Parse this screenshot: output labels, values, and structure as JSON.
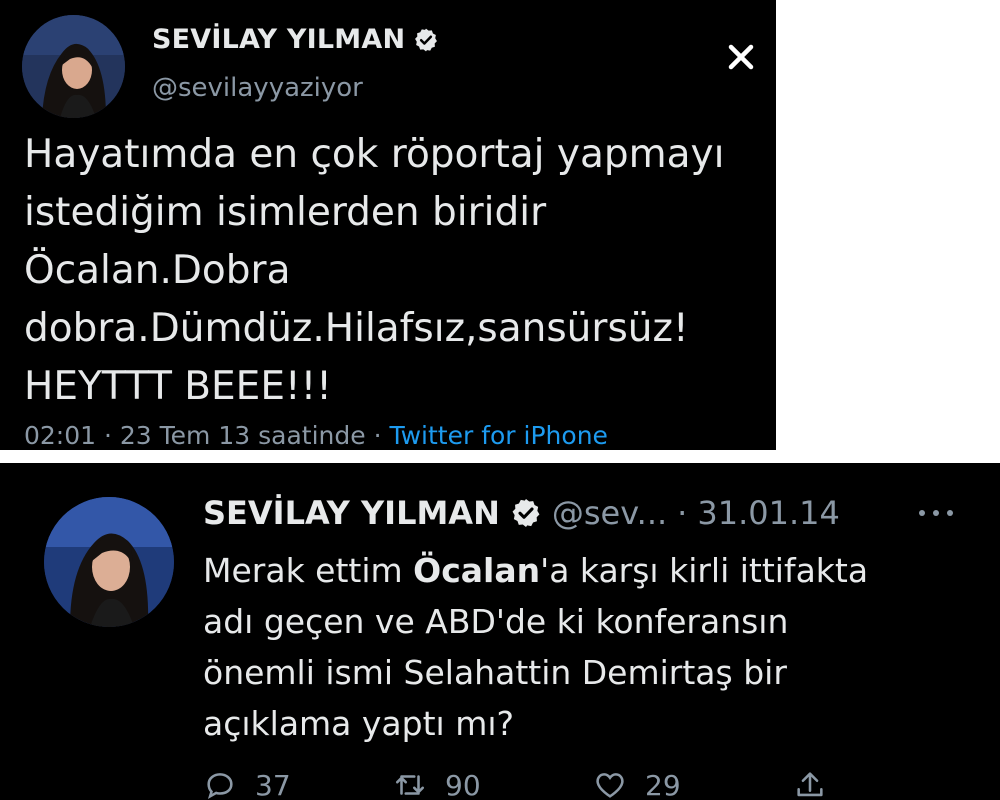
{
  "tweet_top": {
    "name": "SEVİLAY YILMAN",
    "handle": "@sevilayyaziyor",
    "lines": [
      "Hayatımda en çok röportaj yapmayı",
      "istediğim isimlerden biridir",
      "Öcalan.Dobra",
      "dobra.Dümdüz.Hilafsız,sansürsüz!",
      "HEYTTT BEEE!!!"
    ],
    "time": "02:01",
    "sep1": " · ",
    "date": "23 Tem 13 saatinde",
    "sep2": " · ",
    "source": "Twitter for iPhone",
    "icons": {
      "verified": "verified-badge-icon",
      "close": "close-icon"
    }
  },
  "tweet_bottom": {
    "name": "SEVİLAY YILMAN",
    "handle": "@sev...",
    "sep": "·",
    "date": "31.01.14",
    "line1_pre": "Merak ettim ",
    "line1_bold": "Öcalan",
    "line1_post": "'a karşı kirli ittifakta",
    "lines": [
      "adı geçen ve ABD'de ki konferansın",
      "önemli ismi Selahattin Demirtaş bir",
      "açıklama yaptı mı?"
    ],
    "replies": "37",
    "retweets": "90",
    "likes": "29",
    "icons": {
      "verified": "verified-badge-icon",
      "more": "more-options-icon",
      "reply": "reply-icon",
      "retweet": "retweet-icon",
      "like": "heart-icon",
      "share": "share-icon"
    }
  },
  "colors": {
    "background": "#000000",
    "text": "#e7e9ea",
    "secondary": "#8b98a5",
    "link": "#1d9bf0"
  }
}
